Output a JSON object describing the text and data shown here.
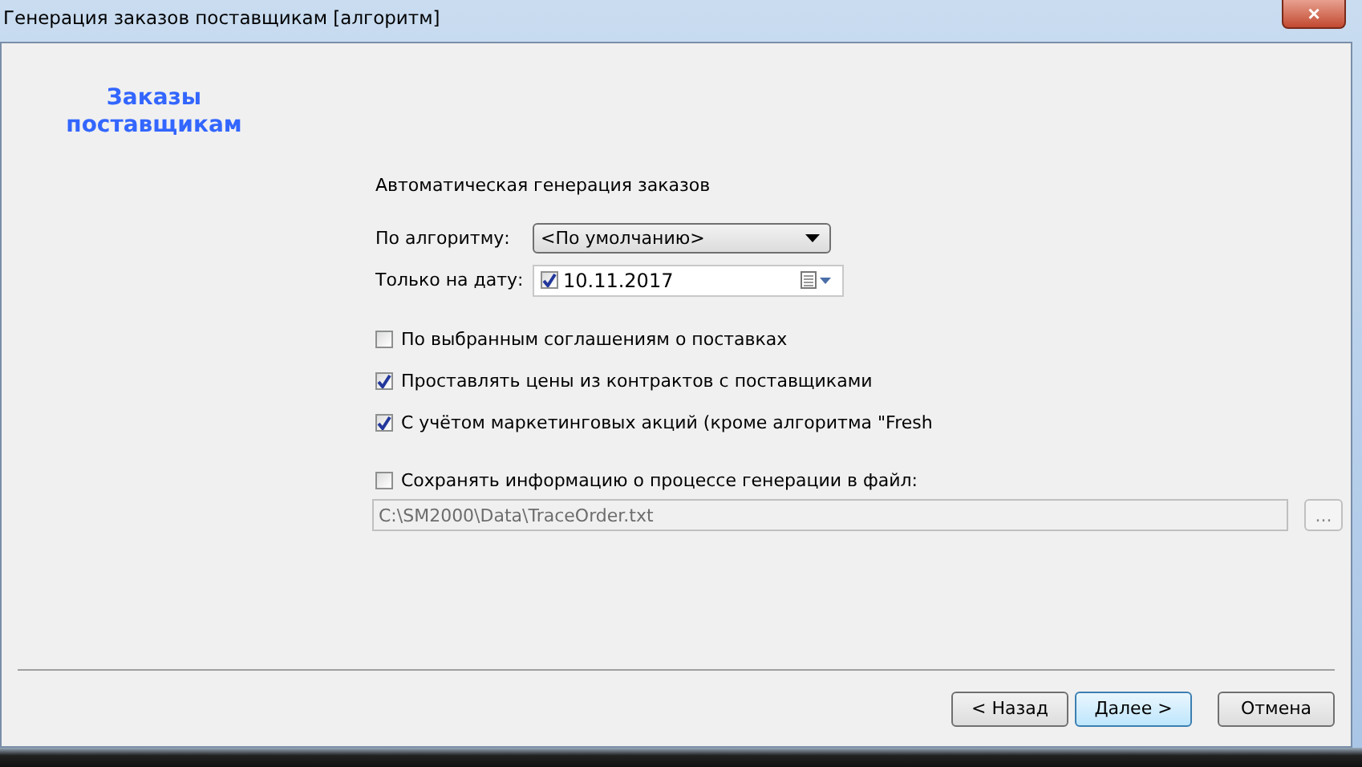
{
  "window": {
    "title": "Генерация заказов поставщикам [алгоритм]",
    "close": "×"
  },
  "heading": "Заказы поставщикам",
  "section_title": "Автоматическая генерация заказов",
  "algorithm": {
    "label": "По алгоритму:",
    "value": "<По умолчанию>"
  },
  "date": {
    "label": "Только на дату:",
    "checked": true,
    "value": "10.11.2017"
  },
  "options": [
    {
      "label": "По выбранным соглашениям о поставках",
      "checked": false
    },
    {
      "label": "Проставлять цены из контрактов с поставщиками",
      "checked": true
    },
    {
      "label": "С учётом маркетинговых акций (кроме алгоритма \"Fresh",
      "checked": true
    }
  ],
  "save_log": {
    "label": "Сохранять информацию о процессе генерации в файл:",
    "checked": false,
    "path": "C:\\SM2000\\Data\\TraceOrder.txt",
    "browse": "...",
    "disabled": true
  },
  "buttons": [
    {
      "label": "< Назад",
      "default": false
    },
    {
      "label": "Далее >",
      "default": true
    },
    {
      "label": "Отмена",
      "default": false
    }
  ]
}
